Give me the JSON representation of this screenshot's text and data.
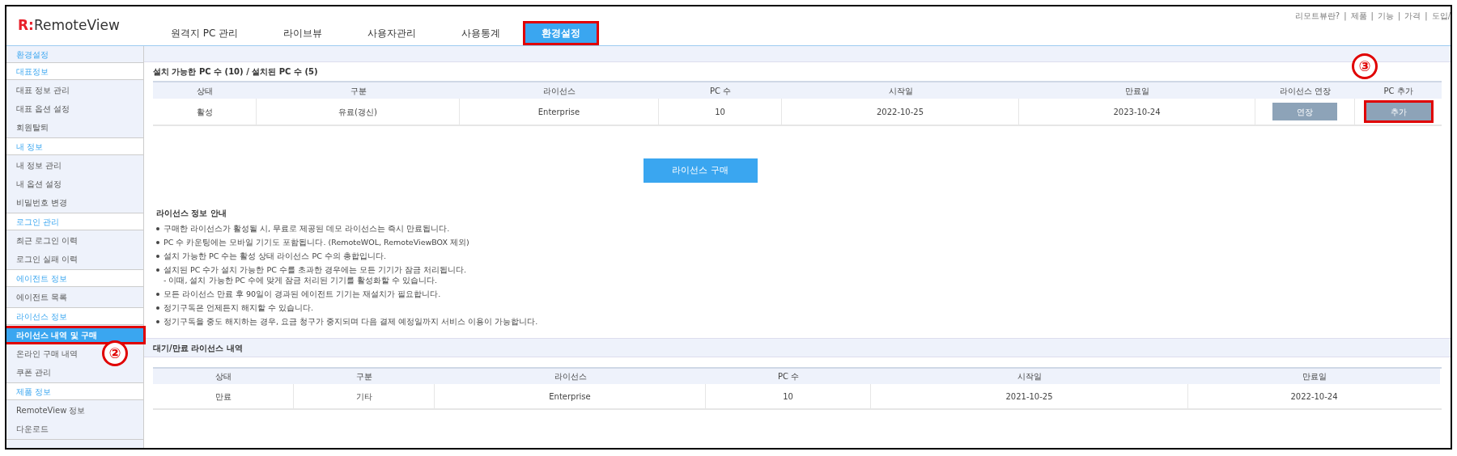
{
  "logo": {
    "mark": "R:",
    "name": "RemoteView"
  },
  "top_links": {
    "separator": "|",
    "items": [
      "리모트뷰란?",
      "제품",
      "기능",
      "가격",
      "도입/"
    ]
  },
  "tabs": [
    {
      "label": "원격지 PC 관리",
      "selected": false,
      "annotated": false
    },
    {
      "label": "라이브뷰",
      "selected": false,
      "annotated": false
    },
    {
      "label": "사용자관리",
      "selected": false,
      "annotated": false
    },
    {
      "label": "사용통계",
      "selected": false,
      "annotated": false
    },
    {
      "label": "환경설정",
      "selected": true,
      "annotated": true
    }
  ],
  "sidebar": {
    "title": "환경설정",
    "sections": [
      {
        "title": "대표정보",
        "items": [
          {
            "label": "대표 정보 관리",
            "selected": false,
            "annotated": false
          },
          {
            "label": "대표 옵션 설정",
            "selected": false,
            "annotated": false
          },
          {
            "label": "회원탈퇴",
            "selected": false,
            "annotated": false
          }
        ]
      },
      {
        "title": "내 정보",
        "items": [
          {
            "label": "내 정보 관리",
            "selected": false,
            "annotated": false
          },
          {
            "label": "내 옵션 설정",
            "selected": false,
            "annotated": false
          },
          {
            "label": "비밀번호 변경",
            "selected": false,
            "annotated": false
          }
        ]
      },
      {
        "title": "로그인 관리",
        "items": [
          {
            "label": "최근 로그인 이력",
            "selected": false,
            "annotated": false
          },
          {
            "label": "로그인 실패 이력",
            "selected": false,
            "annotated": false
          }
        ]
      },
      {
        "title": "에이전트 정보",
        "items": [
          {
            "label": "에이전트 목록",
            "selected": false,
            "annotated": false
          }
        ]
      },
      {
        "title": "라이선스 정보",
        "items": [
          {
            "label": "라이선스 내역 및 구매",
            "selected": true,
            "annotated": true,
            "marker": "②"
          },
          {
            "label": "온라인 구매 내역",
            "selected": false,
            "annotated": false
          },
          {
            "label": "쿠폰 관리",
            "selected": false,
            "annotated": false
          }
        ]
      },
      {
        "title": "제품 정보",
        "items": [
          {
            "label": "RemoteView 정보",
            "selected": false,
            "annotated": false
          },
          {
            "label": "다운로드",
            "selected": false,
            "annotated": false
          }
        ]
      }
    ]
  },
  "license_table": {
    "title": "설치 가능한 PC 수 (10) / 설치된 PC 수 (5)",
    "columns": [
      "상태",
      "구분",
      "라이선스",
      "PC 수",
      "시작일",
      "만료일",
      "라이선스 연장",
      "PC 추가"
    ],
    "rows": [
      [
        {
          "kind": "text",
          "text": "활성"
        },
        {
          "kind": "text",
          "text": "유료(갱신)"
        },
        {
          "kind": "text",
          "text": "Enterprise"
        },
        {
          "kind": "text",
          "text": "10"
        },
        {
          "kind": "text",
          "text": "2022-10-25"
        },
        {
          "kind": "text",
          "text": "2023-10-24"
        },
        {
          "kind": "button",
          "text": "연장",
          "annotated": false
        },
        {
          "kind": "button",
          "text": "추가",
          "annotated": true,
          "marker": "③"
        }
      ]
    ]
  },
  "purchase_button": "라이선스 구매",
  "guide": {
    "title": "라이선스 정보 안내",
    "items": [
      {
        "text": "구매한 라이선스가 활성될 시, 무료로 제공된 데모 라이선스는 즉시 만료됩니다."
      },
      {
        "text": "PC 수 카운팅에는 모바일 기기도 포함됩니다. (RemoteWOL, RemoteViewBOX 제외)"
      },
      {
        "text": "설치 가능한 PC 수는 활성 상태 라이선스 PC 수의 총합입니다."
      },
      {
        "text": "설치된 PC 수가 설치 가능한 PC 수를 초과한 경우에는 모든 기기가 잠금 처리됩니다.",
        "note": "- 이때, 설치 가능한 PC 수에 맞게 잠금 처리된 기기를 활성화할 수 있습니다."
      },
      {
        "text": "모든 라이선스 만료 후 90일이 경과된 에이전트 기기는 재설치가 필요합니다."
      },
      {
        "text": "정기구독은 언제든지 해지할 수 있습니다."
      },
      {
        "text": "정기구독을 중도 해지하는 경우, 요금 청구가 중지되며 다음 결제 예정일까지 서비스 이용이 가능합니다."
      }
    ]
  },
  "expired_table": {
    "title": "대기/만료 라이선스 내역",
    "columns": [
      "상태",
      "구분",
      "라이선스",
      "PC 수",
      "시작일",
      "만료일"
    ],
    "rows": [
      [
        "만료",
        "기타",
        "Enterprise",
        "10",
        "2021-10-25",
        "2022-10-24"
      ]
    ]
  }
}
